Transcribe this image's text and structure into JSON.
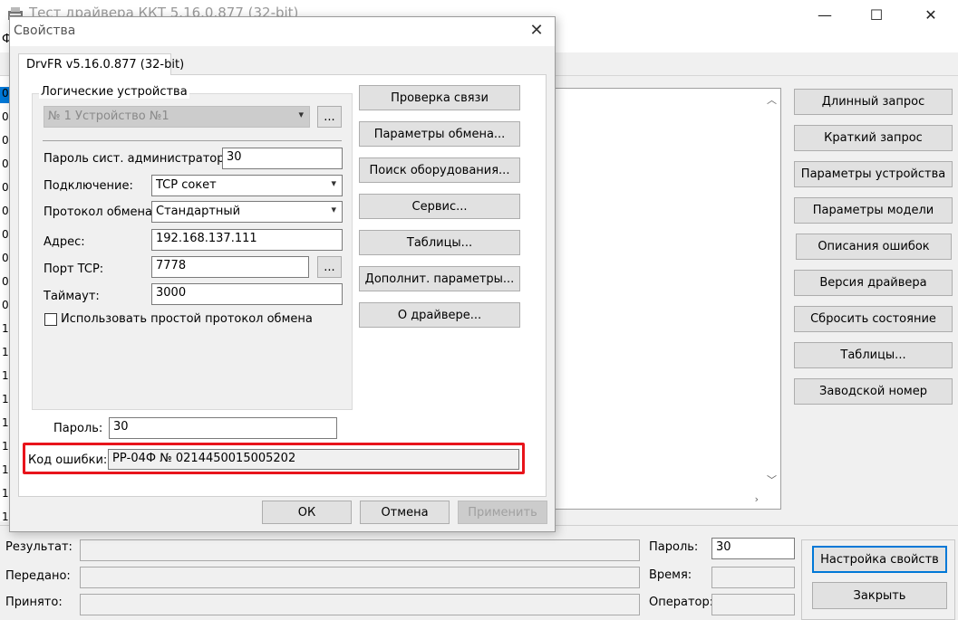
{
  "main_window": {
    "title": "Тест драйвера ККТ 5.16.0.877 (32-bit)",
    "controls": {
      "minimize": "—",
      "maximize": "☐",
      "close": "✕"
    },
    "menu_first_letter": "Ф",
    "left_rows": [
      "0",
      "0",
      "0",
      "0",
      "0",
      "0",
      "0",
      "0",
      "0",
      "0",
      "1",
      "1",
      "1",
      "1",
      "1",
      "1",
      "1",
      "1",
      "1"
    ],
    "right_buttons": [
      "Длинный запрос",
      "Краткий запрос",
      "Параметры устройства",
      "Параметры модели",
      "Описания ошибок",
      "Версия драйвера",
      "Сбросить состояние",
      "Таблицы...",
      "Заводской номер"
    ],
    "bottom": {
      "result_label": "Результат:",
      "sent_label": "Передано:",
      "received_label": "Принято:",
      "password_label": "Пароль:",
      "password_value": "30",
      "time_label": "Время:",
      "operator_label": "Оператор:",
      "setup_button": "Настройка свойств",
      "close_button": "Закрыть"
    }
  },
  "dialog": {
    "title": "Свойства",
    "close": "✕",
    "tab": "DrvFR v5.16.0.877 (32-bit)",
    "group_title": "Логические устройства",
    "device_combo": "№ 1 Устройство №1",
    "ellipsis": "...",
    "admin_password_label": "Пароль сист. администратора",
    "admin_password_value": "30",
    "connection_label": "Подключение:",
    "connection_value": "TCP сокет",
    "protocol_label": "Протокол обмена:",
    "protocol_value": "Стандартный",
    "address_label": "Адрес:",
    "address_value": "192.168.137.111",
    "port_label": "Порт TCP:",
    "port_value": "7778",
    "timeout_label": "Таймаут:",
    "timeout_value": "3000",
    "simple_protocol_label": "Использовать простой протокол обмена",
    "password_label": "Пароль:",
    "password_value": "30",
    "error_code_label": "Код ошибки:",
    "error_code_value": "РР-04Ф № 0214450015005202",
    "right_buttons": [
      "Проверка связи",
      "Параметры обмена...",
      "Поиск оборудования...",
      "Сервис...",
      "Таблицы...",
      "Дополнит. параметры...",
      "О драйвере..."
    ],
    "ok": "ОК",
    "cancel": "Отмена",
    "apply": "Применить"
  },
  "colors": {
    "highlight_frame": "#e8141b",
    "selection": "#0078d7"
  }
}
